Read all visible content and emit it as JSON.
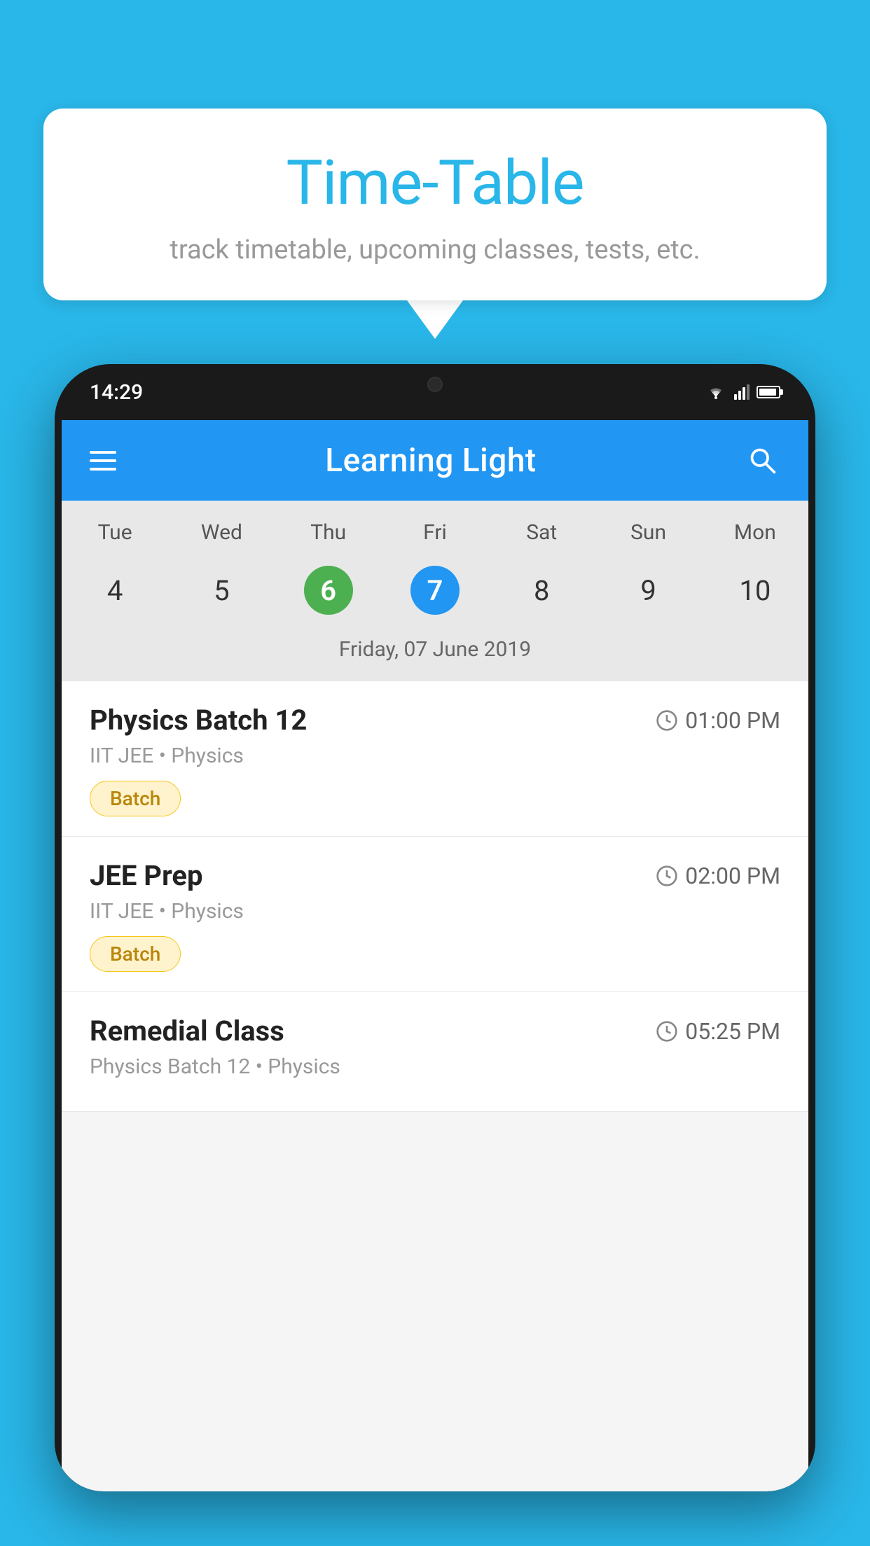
{
  "background_color": "#29b6e8",
  "speech_bubble": {
    "title": "Time-Table",
    "subtitle": "track timetable, upcoming classes, tests, etc."
  },
  "phone": {
    "status_bar": {
      "time": "14:29"
    },
    "app_header": {
      "title": "Learning Light"
    },
    "calendar": {
      "day_labels": [
        "Tue",
        "Wed",
        "Thu",
        "Fri",
        "Sat",
        "Sun",
        "Mon"
      ],
      "dates": [
        {
          "value": "4",
          "style": "normal"
        },
        {
          "value": "5",
          "style": "normal"
        },
        {
          "value": "6",
          "style": "green"
        },
        {
          "value": "7",
          "style": "blue"
        },
        {
          "value": "8",
          "style": "normal"
        },
        {
          "value": "9",
          "style": "normal"
        },
        {
          "value": "10",
          "style": "normal"
        }
      ],
      "current_date_label": "Friday, 07 June 2019"
    },
    "schedule_items": [
      {
        "title": "Physics Batch 12",
        "time": "01:00 PM",
        "subtitle": "IIT JEE • Physics",
        "badge": "Batch"
      },
      {
        "title": "JEE Prep",
        "time": "02:00 PM",
        "subtitle": "IIT JEE • Physics",
        "badge": "Batch"
      },
      {
        "title": "Remedial Class",
        "time": "05:25 PM",
        "subtitle": "Physics Batch 12 • Physics",
        "badge": null
      }
    ]
  },
  "icons": {
    "hamburger": "≡",
    "search": "🔍",
    "clock": "🕐"
  }
}
